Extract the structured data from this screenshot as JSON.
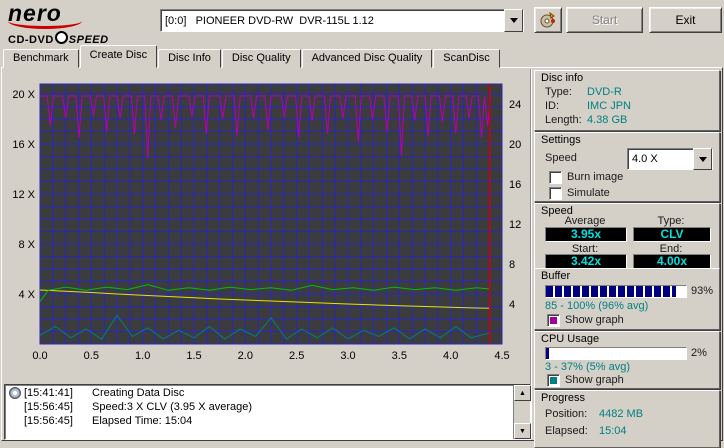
{
  "header": {
    "brand": "nero",
    "subbrand_left": "CD-DVD",
    "subbrand_right": "SPEED",
    "drive": "[0:0]   PIONEER DVD-RW  DVR-115L 1.12",
    "start": "Start",
    "exit": "Exit"
  },
  "tabs": [
    {
      "label": "Benchmark"
    },
    {
      "label": "Create Disc"
    },
    {
      "label": "Disc Info"
    },
    {
      "label": "Disc Quality"
    },
    {
      "label": "Advanced Disc Quality"
    },
    {
      "label": "ScanDisc"
    }
  ],
  "chart_data": {
    "type": "line",
    "x_unit": "GB",
    "x_ticks": [
      "0.0",
      "0.5",
      "1.0",
      "1.5",
      "2.0",
      "2.5",
      "3.0",
      "3.5",
      "4.0",
      "4.5"
    ],
    "left_ticks": [
      "20 X",
      "16 X",
      "12 X",
      "8 X",
      "4 X"
    ],
    "right_ticks": [
      "24",
      "20",
      "16",
      "12",
      "8",
      "4"
    ],
    "x_max_gb": 4.5,
    "end_gb": 4.38,
    "left_axis_max": 20.8,
    "right_axis_max": 26,
    "plot_bg": "#3c3c3c",
    "grid_color": "#2727c3",
    "end_marker_color": "#d40000",
    "series": [
      {
        "name": "cpu-usage",
        "color": "#008080",
        "axis": "left",
        "points": [
          [
            0,
            0.7
          ],
          [
            0.15,
            1.4
          ],
          [
            0.3,
            0.5
          ],
          [
            0.45,
            1.2
          ],
          [
            0.6,
            0.4
          ],
          [
            0.75,
            2.3
          ],
          [
            0.9,
            0.6
          ],
          [
            1.05,
            1.3
          ],
          [
            1.2,
            0.4
          ],
          [
            1.35,
            1.1
          ],
          [
            1.5,
            0.5
          ],
          [
            1.65,
            1.4
          ],
          [
            1.8,
            0.4
          ],
          [
            1.95,
            1.2
          ],
          [
            2.1,
            0.6
          ],
          [
            2.25,
            2.1
          ],
          [
            2.4,
            0.4
          ],
          [
            2.55,
            1.2
          ],
          [
            2.7,
            0.5
          ],
          [
            2.85,
            1.3
          ],
          [
            3.0,
            0.4
          ],
          [
            3.15,
            1.1
          ],
          [
            3.3,
            0.6
          ],
          [
            3.45,
            1.3
          ],
          [
            3.6,
            0.4
          ],
          [
            3.75,
            1.2
          ],
          [
            3.9,
            0.5
          ],
          [
            4.05,
            1.4
          ],
          [
            4.2,
            0.5
          ],
          [
            4.38,
            0.9
          ]
        ]
      },
      {
        "name": "rotation-speed",
        "color": "#e6e600",
        "axis": "left",
        "points": [
          [
            0,
            4.32
          ],
          [
            0.25,
            4.22
          ],
          [
            0.5,
            4.12
          ],
          [
            0.75,
            4.0
          ],
          [
            1.0,
            3.9
          ],
          [
            1.25,
            3.8
          ],
          [
            1.5,
            3.7
          ],
          [
            1.75,
            3.6
          ],
          [
            2.0,
            3.52
          ],
          [
            2.25,
            3.44
          ],
          [
            2.5,
            3.36
          ],
          [
            2.75,
            3.28
          ],
          [
            3.0,
            3.2
          ],
          [
            3.25,
            3.13
          ],
          [
            3.5,
            3.06
          ],
          [
            3.75,
            3.0
          ],
          [
            4.0,
            2.94
          ],
          [
            4.25,
            2.88
          ],
          [
            4.38,
            2.86
          ]
        ]
      },
      {
        "name": "write-speed",
        "color": "#00c000",
        "axis": "left",
        "points": [
          [
            0,
            3.4
          ],
          [
            0.08,
            4.3
          ],
          [
            0.25,
            4.55
          ],
          [
            0.45,
            4.3
          ],
          [
            0.65,
            4.55
          ],
          [
            0.85,
            4.35
          ],
          [
            1.05,
            4.75
          ],
          [
            1.25,
            4.3
          ],
          [
            1.45,
            4.5
          ],
          [
            1.65,
            4.3
          ],
          [
            1.85,
            4.55
          ],
          [
            2.05,
            4.35
          ],
          [
            2.25,
            4.5
          ],
          [
            2.45,
            4.3
          ],
          [
            2.65,
            4.7
          ],
          [
            2.85,
            4.35
          ],
          [
            3.05,
            4.5
          ],
          [
            3.25,
            4.3
          ],
          [
            3.45,
            4.55
          ],
          [
            3.65,
            4.35
          ],
          [
            3.85,
            4.5
          ],
          [
            4.05,
            4.3
          ],
          [
            4.25,
            4.5
          ],
          [
            4.38,
            4.4
          ]
        ]
      },
      {
        "name": "buffer-level",
        "color": "#b400b4",
        "axis": "right",
        "base": 24.8,
        "dips": [
          [
            0.1,
            21.8
          ],
          [
            0.25,
            22.6
          ],
          [
            0.38,
            20.6
          ],
          [
            0.52,
            22.8
          ],
          [
            0.65,
            21.2
          ],
          [
            0.78,
            22.6
          ],
          [
            0.92,
            21.0
          ],
          [
            1.05,
            18.6
          ],
          [
            1.18,
            22.4
          ],
          [
            1.32,
            21.6
          ],
          [
            1.48,
            22.8
          ],
          [
            1.62,
            21.0
          ],
          [
            1.78,
            22.5
          ],
          [
            1.92,
            20.8
          ],
          [
            2.08,
            22.6
          ],
          [
            2.22,
            21.4
          ],
          [
            2.38,
            22.7
          ],
          [
            2.52,
            20.6
          ],
          [
            2.65,
            22.3
          ],
          [
            2.8,
            21.0
          ],
          [
            2.95,
            22.6
          ],
          [
            3.1,
            20.2
          ],
          [
            3.24,
            22.5
          ],
          [
            3.38,
            21.2
          ],
          [
            3.52,
            18.8
          ],
          [
            3.65,
            22.4
          ],
          [
            3.78,
            20.8
          ],
          [
            3.92,
            22.2
          ],
          [
            4.05,
            21.0
          ],
          [
            4.18,
            22.6
          ],
          [
            4.3,
            20.6
          ],
          [
            4.36,
            21.8
          ]
        ]
      }
    ]
  },
  "log": {
    "entries": [
      {
        "time": "[15:41:41]",
        "text": "Creating Data Disc"
      },
      {
        "time": "[15:56:45]",
        "text": "Speed:3 X CLV (3.95 X average)"
      },
      {
        "time": "[15:56:45]",
        "text": "Elapsed Time: 15:04"
      }
    ]
  },
  "disc_info": {
    "title": "Disc info",
    "type_label": "Type:",
    "type": "DVD-R",
    "id_label": "ID:",
    "id": "IMC JPN",
    "length_label": "Length:",
    "length": "4.38 GB"
  },
  "settings": {
    "title": "Settings",
    "speed_label": "Speed",
    "speed_value": "4.0 X",
    "burn_image": "Burn image",
    "simulate": "Simulate"
  },
  "speed": {
    "title": "Speed",
    "average_label": "Average",
    "average": "3.95x",
    "type_label": "Type:",
    "type": "CLV",
    "start_label": "Start:",
    "start": "3.42x",
    "end_label": "End:",
    "end": "4.00x"
  },
  "buffer": {
    "title": "Buffer",
    "percent": 93,
    "percent_label": "93%",
    "range": "85 - 100% (96% avg)",
    "show_graph": "Show graph",
    "color": "#a000a0"
  },
  "cpu": {
    "title": "CPU Usage",
    "percent": 2,
    "percent_label": "2%",
    "range": "3 - 37% (5% avg)",
    "show_graph": "Show graph",
    "color": "#008080"
  },
  "progress": {
    "title": "Progress",
    "position_label": "Position:",
    "position": "4482 MB",
    "elapsed_label": "Elapsed:",
    "elapsed": "15:04"
  }
}
